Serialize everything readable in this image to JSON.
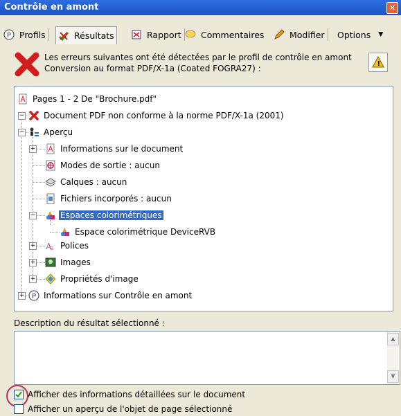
{
  "window": {
    "title": "Contrôle en amont"
  },
  "tabs": [
    {
      "label": "Profils",
      "icon": "profile-icon"
    },
    {
      "label": "Résultats",
      "icon": "results-icon"
    },
    {
      "label": "Rapport",
      "icon": "report-icon"
    },
    {
      "label": "Commentaires",
      "icon": "comments-icon"
    },
    {
      "label": "Modifier",
      "icon": "pencil-icon"
    },
    {
      "label": "Options",
      "icon": "chevron-down-icon"
    }
  ],
  "message": {
    "line1": "Les erreurs suivantes ont été détectées par le profil de contrôle en amont",
    "line2": "Conversion au format PDF/X-1a (Coated FOGRA27) :"
  },
  "tree": [
    {
      "label": "Pages 1 - 2  De \"Brochure.pdf\"",
      "icon": "pdf-icon"
    },
    {
      "label": "Document PDF non conforme à la norme PDF/X-1a (2001)",
      "icon": "error-x-icon"
    },
    {
      "label": "Aperçu",
      "icon": "overview-icon"
    },
    {
      "label": "Informations sur le document",
      "icon": "pdf-icon"
    },
    {
      "label": "Modes de sortie : aucun",
      "icon": "output-icon"
    },
    {
      "label": "Calques : aucun",
      "icon": "layers-icon"
    },
    {
      "label": "Fichiers incorporés : aucun",
      "icon": "file-icon"
    },
    {
      "label": "Espaces colorimétriques",
      "icon": "colorspace-icon"
    },
    {
      "label": "Espace colorimétrique DeviceRVB",
      "icon": "colorspace-icon"
    },
    {
      "label": "Polices",
      "icon": "font-icon"
    },
    {
      "label": "Images",
      "icon": "image-icon"
    },
    {
      "label": "Propriétés d'image",
      "icon": "diamond-icon"
    },
    {
      "label": "Informations sur Contrôle en amont",
      "icon": "profile-icon"
    }
  ],
  "description": {
    "label": "Description du résultat sélectionné :"
  },
  "options": {
    "show_details": {
      "label": "Afficher des informations détaillées sur le document",
      "checked": true
    },
    "show_preview": {
      "label": "Afficher un aperçu de l'objet de page sélectionné",
      "checked": false
    }
  },
  "colors": {
    "selection": "#316ac5",
    "titlebar": "#1f5dd6",
    "error": "#d41c1c"
  }
}
